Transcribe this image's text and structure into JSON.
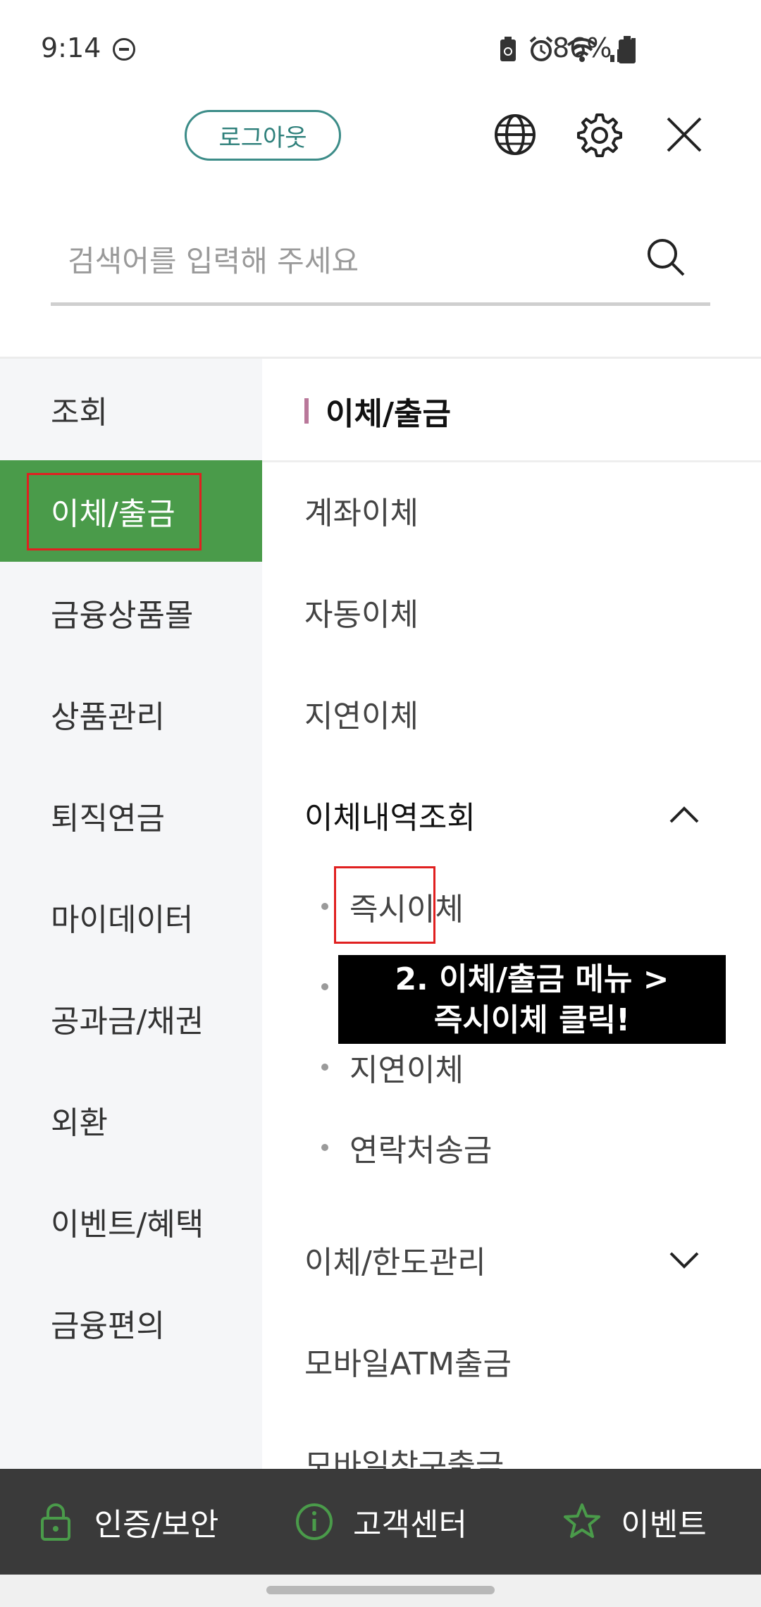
{
  "status_bar": {
    "time": "9:14",
    "battery_percent": "86%",
    "icons": [
      "dnd-icon",
      "battery-saver-icon",
      "alarm-icon",
      "wifi-icon",
      "signal-icon",
      "battery-icon"
    ]
  },
  "header": {
    "logout_label": "로그아웃",
    "icons": [
      "globe-icon",
      "gear-icon",
      "close-icon"
    ]
  },
  "search": {
    "placeholder": "검색어를 입력해 주세요",
    "value": ""
  },
  "left_menu": {
    "items": [
      {
        "label": "조회"
      },
      {
        "label": "이체/출금"
      },
      {
        "label": "금융상품몰"
      },
      {
        "label": "상품관리"
      },
      {
        "label": "퇴직연금"
      },
      {
        "label": "마이데이터"
      },
      {
        "label": "공과금/채권"
      },
      {
        "label": "외환"
      },
      {
        "label": "이벤트/혜택"
      },
      {
        "label": "금융편의"
      }
    ],
    "active_index": 1
  },
  "right_panel": {
    "section_title": "이체/출금",
    "items": [
      {
        "label": "계좌이체"
      },
      {
        "label": "자동이체"
      },
      {
        "label": "지연이체"
      },
      {
        "label": "이체내역조회"
      }
    ],
    "sub_items": [
      {
        "label": "즉시이체"
      },
      {
        "label": ""
      },
      {
        "label": "지연이체"
      },
      {
        "label": "연락처송금"
      }
    ],
    "more_items": [
      {
        "label": "이체/한도관리"
      },
      {
        "label": "모바일ATM출금"
      },
      {
        "label": "모바일창구출금"
      }
    ]
  },
  "callout": {
    "line1": "2. 이체/출금 메뉴 >",
    "line2": "즉시이체 클릭!"
  },
  "bottom_bar": {
    "items": [
      {
        "label": "인증/보안",
        "icon": "lock-icon"
      },
      {
        "label": "고객센터",
        "icon": "info-icon"
      },
      {
        "label": "이벤트",
        "icon": "star-icon"
      }
    ],
    "accent_color": "#4a9b4a"
  },
  "colors": {
    "active_menu": "#4a9b4a",
    "logout_border": "#3c8c88",
    "highlight_box": "#e02020",
    "section_bar": "#b9789a"
  }
}
